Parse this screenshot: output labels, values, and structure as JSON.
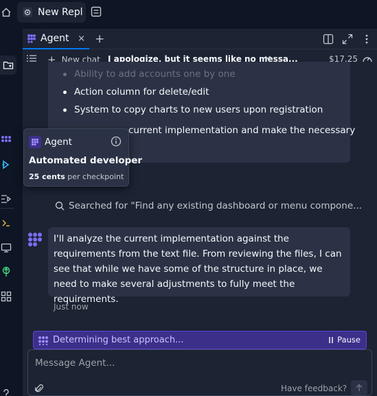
{
  "topbar": {
    "repl_name": "New Repl"
  },
  "tab": {
    "label": "Agent",
    "close": "×",
    "add": "+"
  },
  "chatbar": {
    "new_chat": "New chat",
    "title": "I apologize, but it seems like no messa...",
    "cost": "$17.25"
  },
  "message1": {
    "bullets": [
      "Ability to add accounts one by one",
      "Action column for delete/edit",
      "System to copy charts to new users upon registration"
    ],
    "tail": "current implementation and make the necessary"
  },
  "tooltip": {
    "name": "Agent",
    "role": "Automated developer",
    "price_amount": "25 cents",
    "price_unit": "per checkpoint"
  },
  "search": {
    "text": "Searched for \"Find any existing dashboard or menu compone..."
  },
  "message2": {
    "text": "I'll analyze the current implementation against the requirements from the text file. From reviewing the files, I can see that while we have some of the structure in place, we need to make several adjustments to fully meet the requirements.",
    "timestamp": "Just now"
  },
  "progress": {
    "text": "Determining best approach...",
    "pause_label": "Pause"
  },
  "input": {
    "placeholder": "Message Agent...",
    "feedback": "Have feedback?"
  },
  "colors": {
    "accent": "#0079f2",
    "agent_purple": "#7c6cf2",
    "progress_bg": "#3c2f8a"
  }
}
